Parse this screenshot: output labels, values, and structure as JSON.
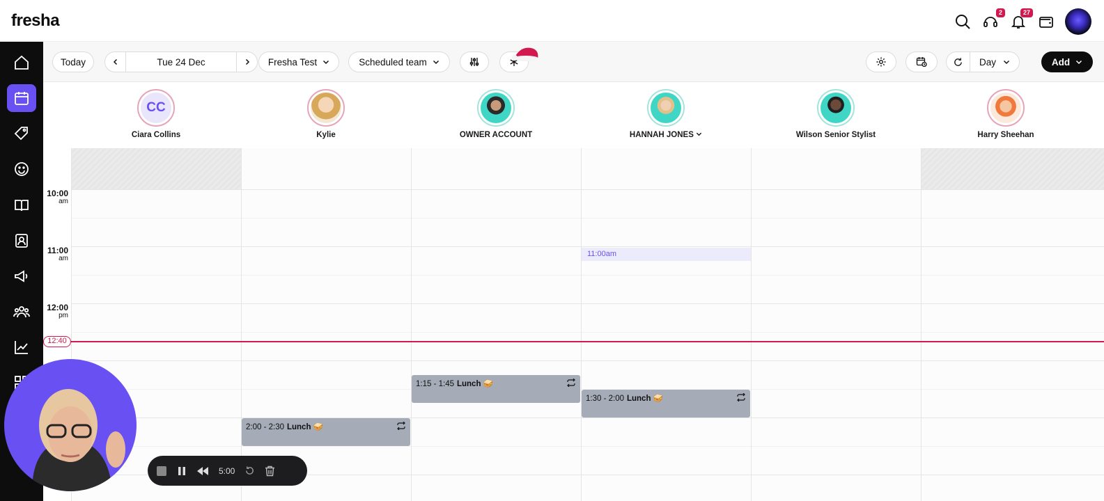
{
  "brand": {
    "logo": "fresha"
  },
  "topbar": {
    "help_badge": "2",
    "notifications_badge": "27"
  },
  "toolbar": {
    "today_label": "Today",
    "date_label": "Tue 24 Dec",
    "location_label": "Fresha Test",
    "team_label": "Scheduled team",
    "view_label": "Day",
    "add_label": "Add"
  },
  "staff": [
    {
      "name": "Ciara Collins",
      "initials": "CC"
    },
    {
      "name": "Kylie"
    },
    {
      "name": "OWNER ACCOUNT"
    },
    {
      "name": "HANNAH JONES"
    },
    {
      "name": "Wilson Senior Stylist"
    },
    {
      "name": "Harry Sheehan"
    }
  ],
  "times": [
    {
      "hour": "10:00",
      "ampm": "am"
    },
    {
      "hour": "11:00",
      "ampm": "am"
    },
    {
      "hour": "12:00",
      "ampm": "pm"
    }
  ],
  "now_label": "12:40",
  "hover_slot_label": "11:00am",
  "appointments": [
    {
      "time": "1:15 - 1:45",
      "title": "Lunch",
      "emoji": "🥪"
    },
    {
      "time": "1:30 - 2:00",
      "title": "Lunch",
      "emoji": "🥪"
    },
    {
      "time": "2:00 - 2:30",
      "title": "Lunch",
      "emoji": "🥪"
    }
  ],
  "recorder": {
    "time": "5:00"
  },
  "colors": {
    "accent": "#6950f3",
    "now": "#d1184f",
    "appointment": "#a5abb7"
  }
}
